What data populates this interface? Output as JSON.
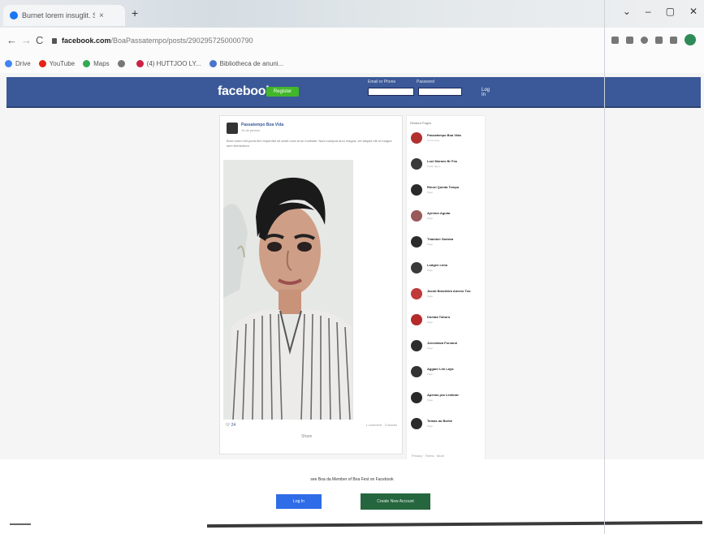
{
  "browser": {
    "tab_title": "Burnet lorem insuglit. Sebeer",
    "tab_close": "×",
    "new_tab": "+",
    "window_controls": [
      "⌄",
      "–",
      "▢",
      "✕"
    ],
    "url_host": "facebook.com",
    "url_path": "/BoaPassatempo/posts/2902957250000790",
    "nav": {
      "back": "←",
      "forward": "→",
      "reload": "C"
    },
    "bookmarks": [
      {
        "label": "Drive",
        "color": "#4285f4"
      },
      {
        "label": "YouTube",
        "color": "#e62117"
      },
      {
        "label": "Maps",
        "color": "#34a853"
      },
      {
        "label": "",
        "color": "#777"
      },
      {
        "label": "(4) HUTTJOO LY...",
        "color": "#cc2244"
      },
      {
        "label": "Bibliotheca de anuni...",
        "color": "#4a74c9"
      }
    ]
  },
  "fb": {
    "logo": "facebook",
    "signup_button": "Register",
    "login_email_label": "Email or Phone",
    "login_password_label": "Password",
    "login_button": "Log In",
    "brand_color": "#3b5998",
    "post": {
      "author": "Passatempo Boa Vida",
      "date": "15 de janeiro",
      "text": "Bore lorem elit porta lem imperdiet sit amet urna at se molestie. Nam volutpat arcu magna, vel aliquet elit ut magna sem fermentum.",
      "reactions": "🤍 24",
      "comments": "1 comment · 3 shares",
      "share": "Share"
    },
    "sidebar": {
      "header": "Related Pages",
      "footer": "Privacy · Terms · More",
      "pages": [
        {
          "name": "Passatempo Boa Vida",
          "meta": "Community",
          "color": "#b23030"
        },
        {
          "name": "Luci Moraes Br Fos",
          "meta": "Public figure",
          "color": "#3a3a3a"
        },
        {
          "name": "Rinori Quinta Tempo",
          "meta": "Page",
          "color": "#2a2a2a"
        },
        {
          "name": "Ayreton Aguiar",
          "meta": "Page",
          "color": "#9a5a5a"
        },
        {
          "name": "Thamber Saraiva",
          "meta": "Page",
          "color": "#2c2c2c"
        },
        {
          "name": "Lodgen Lima",
          "meta": "Page",
          "color": "#3a3a3a"
        },
        {
          "name": "Jacob Brasileira Ameno Tuo",
          "meta": "Page",
          "color": "#c03a3a"
        },
        {
          "name": "Domba Toboro",
          "meta": "Page",
          "color": "#b52a2a"
        },
        {
          "name": "Jorcintava Forvarol",
          "meta": "Page",
          "color": "#2d2d2d"
        },
        {
          "name": "Agganr Lim Laya",
          "meta": "Page",
          "color": "#333"
        },
        {
          "name": "Apenas pra Lembrar",
          "meta": "Page",
          "color": "#2a2a2a"
        },
        {
          "name": "Tomas ao Borbe",
          "meta": "Page",
          "color": "#2b2b2b"
        }
      ]
    },
    "banner": {
      "text": "see Boa da Member of Boa Fest on Facebook",
      "login_button": "Log In",
      "create_button": "Create New Account"
    }
  }
}
